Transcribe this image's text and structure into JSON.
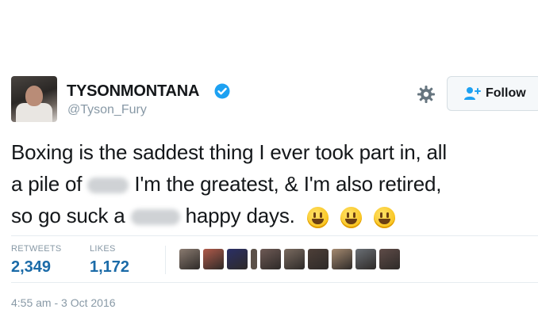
{
  "author": {
    "display_name": "TYSONMONTANA",
    "handle": "@Tyson_Fury",
    "verified": true
  },
  "actions": {
    "follow_label": "Follow"
  },
  "tweet": {
    "line1": "Boxing is the saddest thing I ever took part in, all",
    "line2_before": "a pile of",
    "line2_after": "I'm the greatest, & I'm also retired,",
    "line3_before": "so go suck a",
    "line3_after": "happy days.",
    "emoji_count": 3
  },
  "stats": {
    "retweets_label": "RETWEETS",
    "retweets_value": "2,349",
    "likes_label": "LIKES",
    "likes_value": "1,172"
  },
  "likers": {
    "colors": [
      "#8a7b70",
      "#b05a4a",
      "#2a2f66",
      "#5b5048",
      "#6e5a55",
      "#7a6b60",
      "#4d3f38",
      "#a58a70",
      "#6a6f75",
      "#5f4c48"
    ]
  },
  "timestamp": "4:55 am - 3 Oct 2016",
  "colors": {
    "link_blue": "#1b6ba8",
    "muted": "#8899a6",
    "verified_blue": "#1da1f2"
  }
}
